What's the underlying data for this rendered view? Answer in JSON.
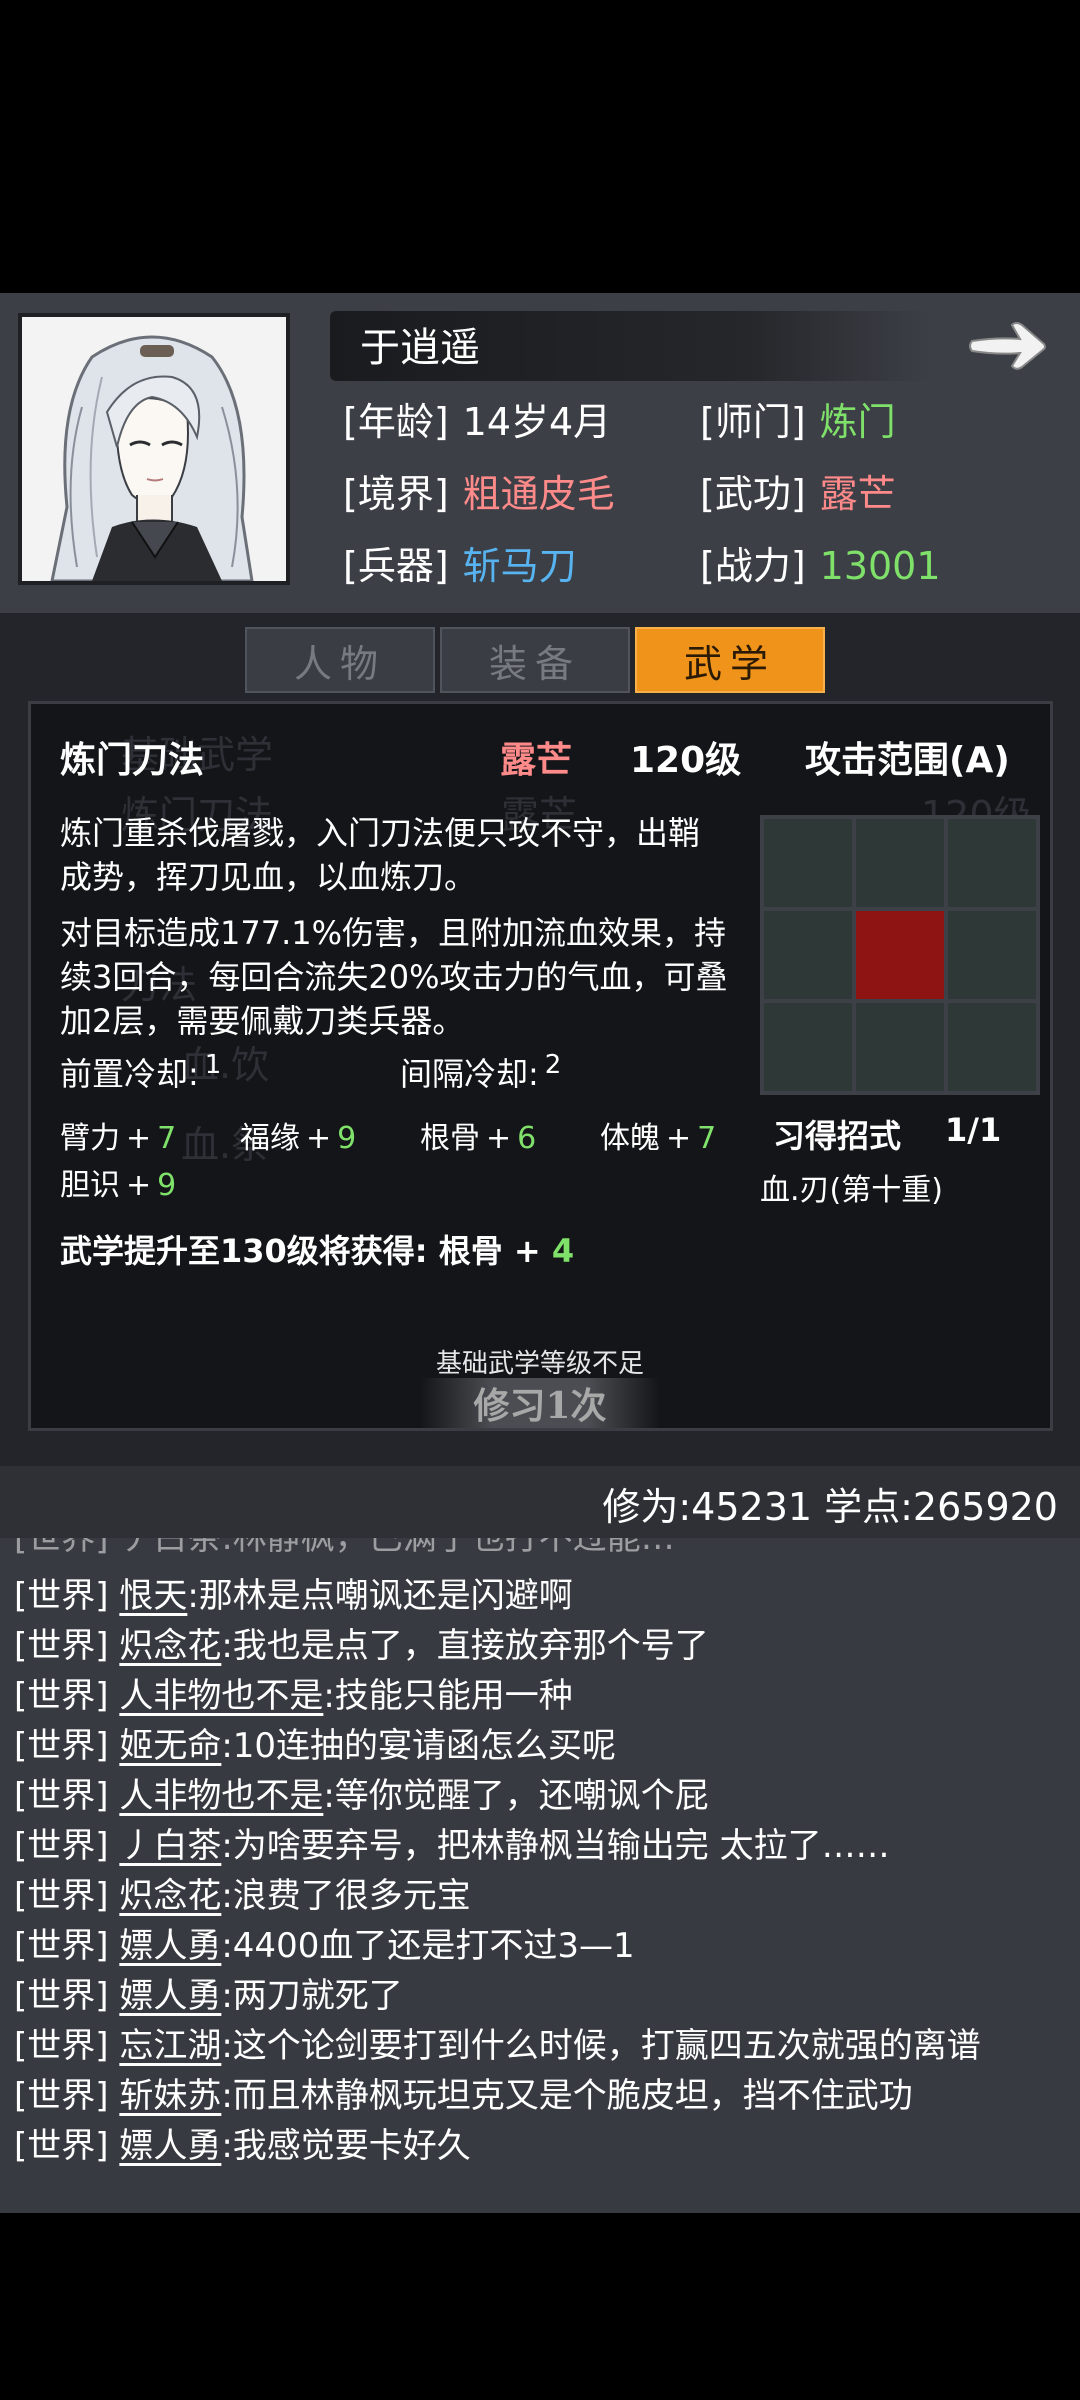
{
  "character": {
    "name": "于逍遥",
    "attributes": [
      {
        "label": "[年龄]",
        "value": "14岁4月",
        "color": "#ffffff"
      },
      {
        "label": "[师门]",
        "value": "炼门",
        "color": "#7fe06a"
      },
      {
        "label": "[境界]",
        "value": "粗通皮毛",
        "color": "#ff8a8a"
      },
      {
        "label": "[武功]",
        "value": "露芒",
        "color": "#ff8a8a"
      },
      {
        "label": "[兵器]",
        "value": "斩马刀",
        "color": "#58b4f0"
      },
      {
        "label": "[战力]",
        "value": "13001",
        "color": "#7fe06a"
      }
    ]
  },
  "tabs": [
    {
      "label": "人物",
      "active": false
    },
    {
      "label": "装备",
      "active": false
    },
    {
      "label": "武学",
      "active": true
    }
  ],
  "skill": {
    "name": "炼门刀法",
    "school": "露芒",
    "level": "120级",
    "range_label": "攻击范围(A)",
    "description": "炼门重杀伐屠戮，入门刀法便只攻不守，出鞘成势，挥刀见血，以血炼刀。",
    "effect_lines": [
      "对目标造成177.1%伤害，且附加流血效果，持",
      "续3回合，每回合流失20%攻击力的气血，可叠",
      "加2层，需要佩戴刀类兵器。"
    ],
    "description_lines": [
      "炼门重杀伐屠戮，入门刀法便只攻不守，出鞘",
      "成势，挥刀见血，以血炼刀。"
    ],
    "pre_cooldown_label": "前置冷却:",
    "pre_cooldown_value": "1",
    "interval_cooldown_label": "间隔冷却:",
    "interval_cooldown_value": "2",
    "stats": [
      {
        "label": "臂力",
        "value": "7"
      },
      {
        "label": "福缘",
        "value": "9"
      },
      {
        "label": "根骨",
        "value": "6"
      },
      {
        "label": "体魄",
        "value": "7"
      },
      {
        "label": "胆识",
        "value": "9"
      }
    ],
    "learned_label": "习得招式",
    "learned_count": "1/1",
    "learned_move": "血.刃(第十重)",
    "upgrade_prefix": "武学提升至130级将获得: 根骨 +",
    "upgrade_value": "4",
    "practice_hint": "基础武学等级不足",
    "practice_button": "修习1次",
    "range_grid_highlight": "center",
    "background_list": [
      "基础武学",
      "炼门刀法",
      "刀法",
      "血.饮",
      "血.祭"
    ],
    "background_levels": [
      "露芒",
      "120级"
    ]
  },
  "points": {
    "text": "修为:45231 学点:265920"
  },
  "chat": {
    "cut_line": "[世界] 丿白茶:林静枫，已满了也打不过能…",
    "messages": [
      {
        "channel": "[世界]",
        "user": "恨天",
        "text": ":那林是点嘲讽还是闪避啊"
      },
      {
        "channel": "[世界]",
        "user": "炽念花",
        "text": ":我也是点了，直接放弃那个号了"
      },
      {
        "channel": "[世界]",
        "user": "人非物也不是",
        "text": ":技能只能用一种"
      },
      {
        "channel": "[世界]",
        "user": "姬无命",
        "text": ":10连抽的宴请函怎么买呢"
      },
      {
        "channel": "[世界]",
        "user": "人非物也不是",
        "text": ":等你觉醒了，还嘲讽个屁"
      },
      {
        "channel": "[世界]",
        "user": "丿白茶",
        "text": ":为啥要弃号，把林静枫当输出完 太拉了……"
      },
      {
        "channel": "[世界]",
        "user": "炽念花",
        "text": ":浪费了很多元宝"
      },
      {
        "channel": "[世界]",
        "user": "嫖人勇",
        "text": ":4400血了还是打不过3—1"
      },
      {
        "channel": "[世界]",
        "user": "嫖人勇",
        "text": ":两刀就死了"
      },
      {
        "channel": "[世界]",
        "user": "忘江湖",
        "text": ":这个论剑要打到什么时候，打赢四五次就强的离谱"
      },
      {
        "channel": "[世界]",
        "user": "斩妹苏",
        "text": ":而且林静枫玩坦克又是个脆皮坦，挡不住武功"
      },
      {
        "channel": "[世界]",
        "user": "嫖人勇",
        "text": ":我感觉要卡好久"
      }
    ]
  }
}
